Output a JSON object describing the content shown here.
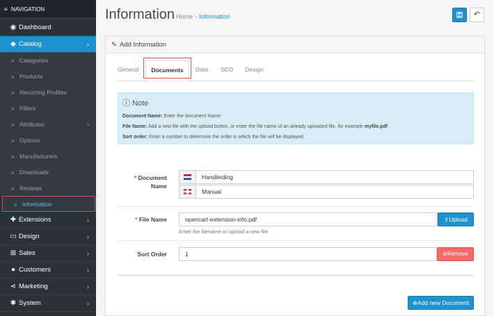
{
  "sidebar": {
    "header": "NAVIGATION",
    "items": [
      {
        "label": "Dashboard"
      },
      {
        "label": "Catalog"
      },
      {
        "label": "Extensions"
      },
      {
        "label": "Design"
      },
      {
        "label": "Sales"
      },
      {
        "label": "Customers"
      },
      {
        "label": "Marketing"
      },
      {
        "label": "System"
      }
    ],
    "catalog_sub": [
      {
        "label": "Categories"
      },
      {
        "label": "Products"
      },
      {
        "label": "Recurring Profiles"
      },
      {
        "label": "Filters"
      },
      {
        "label": "Attributes"
      },
      {
        "label": "Options"
      },
      {
        "label": "Manufacturers"
      },
      {
        "label": "Downloads"
      },
      {
        "label": "Reviews"
      },
      {
        "label": "Information"
      }
    ]
  },
  "header": {
    "title": "Information",
    "breadcrumb": [
      "Home",
      "Information"
    ],
    "breadcrumb_sep": "›"
  },
  "panel": {
    "heading": "Add Information",
    "tabs": [
      {
        "label": "General"
      },
      {
        "label": "Documents"
      },
      {
        "label": "Data"
      },
      {
        "label": "SEO"
      },
      {
        "label": "Design"
      }
    ]
  },
  "note": {
    "title": "Note",
    "lines": [
      {
        "bold": "Document Name:",
        "text": " Enter the document Name"
      },
      {
        "bold": "File Name:",
        "text": " Add a new file with the upload button, or enter the file name of an already uploaded file, for example ",
        "bold2": "myfile.pdf"
      },
      {
        "bold": "Sort order:",
        "text": " Enter a number to determine the order in which the file will be displayed"
      }
    ]
  },
  "form": {
    "required_mark": "*",
    "document_name_label": "Document Name",
    "document_name_values": [
      "Handleiding",
      "Manual"
    ],
    "file_name_label": "File Name",
    "file_name_value": "opencart-extension-info.pdf",
    "file_name_help": "Enter the filename or upload a new file",
    "upload_button": "Upload",
    "sort_order_label": "Sort Order",
    "sort_order_value": "1",
    "remove_button": "Remove",
    "add_button": "Add new Document"
  },
  "colors": {
    "accent": "#1e91cf",
    "sidebar": "#2a3139",
    "danger": "#f56b6b"
  }
}
